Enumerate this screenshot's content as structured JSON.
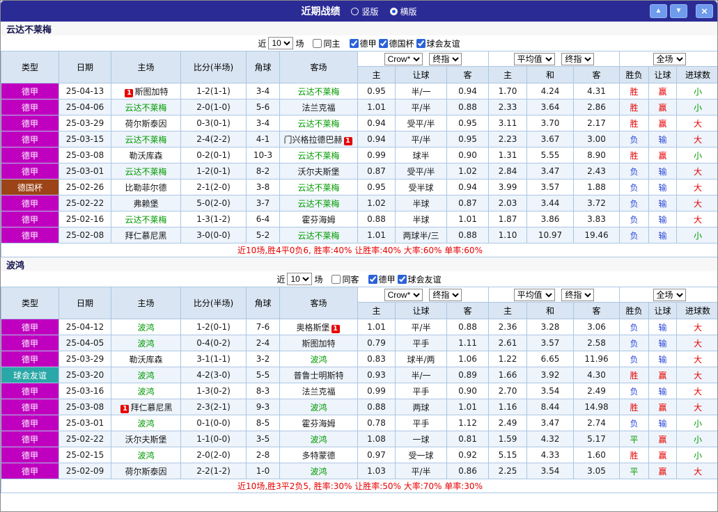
{
  "topbar": {
    "title": "近期战绩",
    "layout_vertical": "竖版",
    "layout_horizontal": "横版",
    "up_icon": "▲",
    "down_icon": "▼",
    "close_icon": "×"
  },
  "colors": {
    "comps": {
      "德甲": "#bf00bf",
      "德国杯": "#9c4317",
      "球会友谊": "#2aa7a7"
    },
    "outcome": {
      "胜": "#e60000",
      "负": "#2b48d8",
      "平": "#009900",
      "赢": "#e60000",
      "输": "#2b48d8",
      "大": "#e60000",
      "小": "#009900"
    }
  },
  "table_headers": {
    "type": "类型",
    "date": "日期",
    "home": "主场",
    "score": "比分(半场)",
    "corners": "角球",
    "away": "客场",
    "h": "主",
    "handicap": "让球",
    "a": "客",
    "avg_h": "主",
    "avg_d": "和",
    "avg_a": "客",
    "result": "胜负",
    "handicap_result": "让球",
    "goals": "进球数"
  },
  "sections": [
    {
      "team": "云达不莱梅",
      "filter": {
        "near": "近",
        "count": "10",
        "games": "场",
        "same": {
          "label": "同主",
          "checked": false
        },
        "comps": [
          {
            "label": "德甲",
            "checked": true
          },
          {
            "label": "德国杯",
            "checked": true
          },
          {
            "label": "球会友谊",
            "checked": true
          }
        ]
      },
      "selects": {
        "odds_source": "Crow*",
        "final_a": "终指",
        "avg": "平均值",
        "final_b": "终指",
        "scope": "全场"
      },
      "rows": [
        {
          "comp": "德甲",
          "date": "25-04-13",
          "home": "斯图加特",
          "home_badge": "1",
          "home_badge_pos": "before",
          "score": "1-2(1-1)",
          "corners": "3-4",
          "away": "云达不莱梅",
          "odds": [
            "0.95",
            "半/一",
            "0.94"
          ],
          "avg": [
            "1.70",
            "4.24",
            "4.31"
          ],
          "result": "胜",
          "handicap_result": "赢",
          "goals": "小"
        },
        {
          "comp": "德甲",
          "date": "25-04-06",
          "home": "云达不莱梅",
          "score": "2-0(1-0)",
          "corners": "5-6",
          "away": "法兰克福",
          "odds": [
            "1.01",
            "平/半",
            "0.88"
          ],
          "avg": [
            "2.33",
            "3.64",
            "2.86"
          ],
          "result": "胜",
          "handicap_result": "赢",
          "goals": "小"
        },
        {
          "comp": "德甲",
          "date": "25-03-29",
          "home": "荷尔斯泰因",
          "score": "0-3(0-1)",
          "corners": "3-4",
          "away": "云达不莱梅",
          "odds": [
            "0.94",
            "受平/半",
            "0.95"
          ],
          "avg": [
            "3.11",
            "3.70",
            "2.17"
          ],
          "result": "胜",
          "handicap_result": "赢",
          "goals": "大"
        },
        {
          "comp": "德甲",
          "date": "25-03-15",
          "home": "云达不莱梅",
          "score": "2-4(2-2)",
          "corners": "4-1",
          "away": "门兴格拉德巴赫",
          "away_badge": "1",
          "away_badge_pos": "after",
          "odds": [
            "0.94",
            "平/半",
            "0.95"
          ],
          "avg": [
            "2.23",
            "3.67",
            "3.00"
          ],
          "result": "负",
          "handicap_result": "输",
          "goals": "大"
        },
        {
          "comp": "德甲",
          "date": "25-03-08",
          "home": "勒沃库森",
          "score": "0-2(0-1)",
          "corners": "10-3",
          "away": "云达不莱梅",
          "odds": [
            "0.99",
            "球半",
            "0.90"
          ],
          "avg": [
            "1.31",
            "5.55",
            "8.90"
          ],
          "result": "胜",
          "handicap_result": "赢",
          "goals": "小"
        },
        {
          "comp": "德甲",
          "date": "25-03-01",
          "home": "云达不莱梅",
          "score": "1-2(0-1)",
          "corners": "8-2",
          "away": "沃尔夫斯堡",
          "odds": [
            "0.87",
            "受平/半",
            "1.02"
          ],
          "avg": [
            "2.84",
            "3.47",
            "2.43"
          ],
          "result": "负",
          "handicap_result": "输",
          "goals": "大"
        },
        {
          "comp": "德国杯",
          "date": "25-02-26",
          "home": "比勒菲尔德",
          "score": "2-1(2-0)",
          "corners": "3-8",
          "away": "云达不莱梅",
          "odds": [
            "0.95",
            "受半球",
            "0.94"
          ],
          "avg": [
            "3.99",
            "3.57",
            "1.88"
          ],
          "result": "负",
          "handicap_result": "输",
          "goals": "大"
        },
        {
          "comp": "德甲",
          "date": "25-02-22",
          "home": "弗赖堡",
          "score": "5-0(2-0)",
          "corners": "3-7",
          "away": "云达不莱梅",
          "odds": [
            "1.02",
            "半球",
            "0.87"
          ],
          "avg": [
            "2.03",
            "3.44",
            "3.72"
          ],
          "result": "负",
          "handicap_result": "输",
          "goals": "大"
        },
        {
          "comp": "德甲",
          "date": "25-02-16",
          "home": "云达不莱梅",
          "score": "1-3(1-2)",
          "corners": "6-4",
          "away": "霍芬海姆",
          "odds": [
            "0.88",
            "半球",
            "1.01"
          ],
          "avg": [
            "1.87",
            "3.86",
            "3.83"
          ],
          "result": "负",
          "handicap_result": "输",
          "goals": "大"
        },
        {
          "comp": "德甲",
          "date": "25-02-08",
          "home": "拜仁慕尼黑",
          "score": "3-0(0-0)",
          "corners": "5-2",
          "away": "云达不莱梅",
          "odds": [
            "1.01",
            "两球半/三",
            "0.88"
          ],
          "avg": [
            "1.10",
            "10.97",
            "19.46"
          ],
          "result": "负",
          "handicap_result": "输",
          "goals": "小"
        }
      ],
      "summary": "近10场,胜4平0负6, 胜率:40% 让胜率:40% 大率:60% 单率:60%"
    },
    {
      "team": "波鸿",
      "filter": {
        "near": "近",
        "count": "10",
        "games": "场",
        "same": {
          "label": "同客",
          "checked": false
        },
        "comps": [
          {
            "label": "德甲",
            "checked": true
          },
          {
            "label": "球会友谊",
            "checked": true
          }
        ]
      },
      "selects": {
        "odds_source": "Crow*",
        "final_a": "终指",
        "avg": "平均值",
        "final_b": "终指",
        "scope": "全场"
      },
      "rows": [
        {
          "comp": "德甲",
          "date": "25-04-12",
          "home": "波鸿",
          "score": "1-2(0-1)",
          "corners": "7-6",
          "away": "奥格斯堡",
          "away_badge": "1",
          "away_badge_pos": "after",
          "odds": [
            "1.01",
            "平/半",
            "0.88"
          ],
          "avg": [
            "2.36",
            "3.28",
            "3.06"
          ],
          "result": "负",
          "handicap_result": "输",
          "goals": "大"
        },
        {
          "comp": "德甲",
          "date": "25-04-05",
          "home": "波鸿",
          "score": "0-4(0-2)",
          "corners": "2-4",
          "away": "斯图加特",
          "odds": [
            "0.79",
            "平手",
            "1.11"
          ],
          "avg": [
            "2.61",
            "3.57",
            "2.58"
          ],
          "result": "负",
          "handicap_result": "输",
          "goals": "大"
        },
        {
          "comp": "德甲",
          "date": "25-03-29",
          "home": "勒沃库森",
          "score": "3-1(1-1)",
          "corners": "3-2",
          "away": "波鸿",
          "odds": [
            "0.83",
            "球半/两",
            "1.06"
          ],
          "avg": [
            "1.22",
            "6.65",
            "11.96"
          ],
          "result": "负",
          "handicap_result": "输",
          "goals": "大"
        },
        {
          "comp": "球会友谊",
          "date": "25-03-20",
          "home": "波鸿",
          "score": "4-2(3-0)",
          "corners": "5-5",
          "away": "普鲁士明斯特",
          "odds": [
            "0.93",
            "半/一",
            "0.89"
          ],
          "avg": [
            "1.66",
            "3.92",
            "4.30"
          ],
          "result": "胜",
          "handicap_result": "赢",
          "goals": "大"
        },
        {
          "comp": "德甲",
          "date": "25-03-16",
          "home": "波鸿",
          "score": "1-3(0-2)",
          "corners": "8-3",
          "away": "法兰克福",
          "odds": [
            "0.99",
            "平手",
            "0.90"
          ],
          "avg": [
            "2.70",
            "3.54",
            "2.49"
          ],
          "result": "负",
          "handicap_result": "输",
          "goals": "大"
        },
        {
          "comp": "德甲",
          "date": "25-03-08",
          "home": "拜仁慕尼黑",
          "home_badge": "1",
          "home_badge_pos": "before",
          "score": "2-3(2-1)",
          "corners": "9-3",
          "away": "波鸿",
          "odds": [
            "0.88",
            "两球",
            "1.01"
          ],
          "avg": [
            "1.16",
            "8.44",
            "14.98"
          ],
          "result": "胜",
          "handicap_result": "赢",
          "goals": "大"
        },
        {
          "comp": "德甲",
          "date": "25-03-01",
          "home": "波鸿",
          "score": "0-1(0-0)",
          "corners": "8-5",
          "away": "霍芬海姆",
          "odds": [
            "0.78",
            "平手",
            "1.12"
          ],
          "avg": [
            "2.49",
            "3.47",
            "2.74"
          ],
          "result": "负",
          "handicap_result": "输",
          "goals": "小"
        },
        {
          "comp": "德甲",
          "date": "25-02-22",
          "home": "沃尔夫斯堡",
          "score": "1-1(0-0)",
          "corners": "3-5",
          "away": "波鸿",
          "odds": [
            "1.08",
            "一球",
            "0.81"
          ],
          "avg": [
            "1.59",
            "4.32",
            "5.17"
          ],
          "result": "平",
          "handicap_result": "赢",
          "goals": "小"
        },
        {
          "comp": "德甲",
          "date": "25-02-15",
          "home": "波鸿",
          "score": "2-0(2-0)",
          "corners": "2-8",
          "away": "多特蒙德",
          "odds": [
            "0.97",
            "受一球",
            "0.92"
          ],
          "avg": [
            "5.15",
            "4.33",
            "1.60"
          ],
          "result": "胜",
          "handicap_result": "赢",
          "goals": "小"
        },
        {
          "comp": "德甲",
          "date": "25-02-09",
          "home": "荷尔斯泰因",
          "score": "2-2(1-2)",
          "corners": "1-0",
          "away": "波鸿",
          "odds": [
            "1.03",
            "平/半",
            "0.86"
          ],
          "avg": [
            "2.25",
            "3.54",
            "3.05"
          ],
          "result": "平",
          "handicap_result": "赢",
          "goals": "大"
        }
      ],
      "summary": "近10场,胜3平2负5, 胜率:30% 让胜率:50% 大率:70% 单率:30%"
    }
  ]
}
